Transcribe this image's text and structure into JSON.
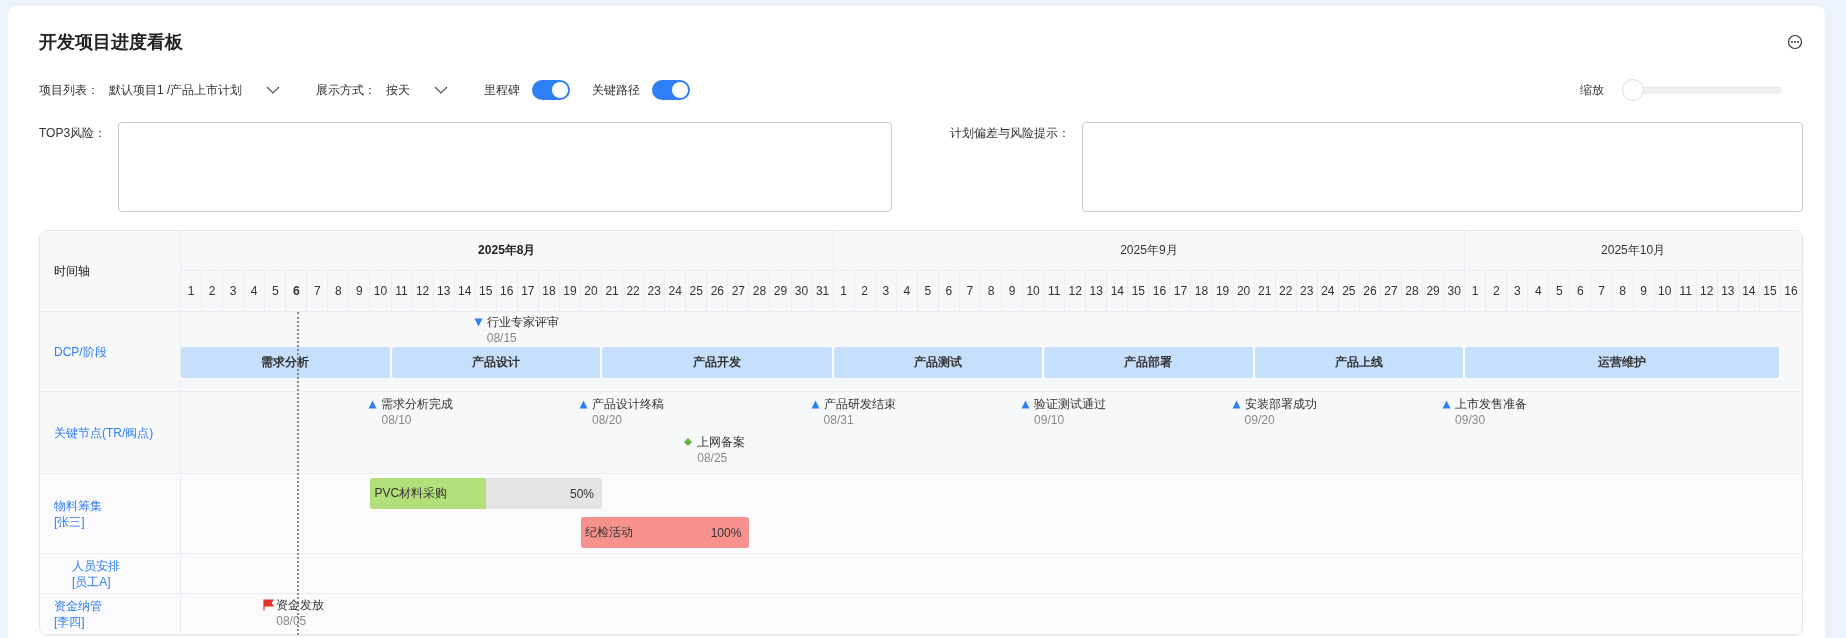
{
  "title": "开发项目进度看板",
  "filters": [
    {
      "kind": "select",
      "label": "项目列表：",
      "value": "默认项目1 /产品上市计划"
    },
    {
      "kind": "select",
      "label": "展示方式：",
      "value": "按天"
    },
    {
      "kind": "toggle",
      "label": "里程碑",
      "on": true
    },
    {
      "kind": "toggle",
      "label": "关键路径",
      "on": true
    }
  ],
  "zoom": {
    "label": "缩放",
    "level": 0
  },
  "risks": [
    {
      "label": "TOP3风险："
    },
    {
      "label": "计划偏差与风险提示："
    }
  ],
  "timeline": {
    "corner": "时间轴",
    "months": [
      {
        "label": "2025年8月",
        "current": true,
        "days": [
          {
            "label": "1",
            "today": false
          },
          {
            "label": "2",
            "today": false
          },
          {
            "label": "3",
            "today": false
          },
          {
            "label": "4",
            "today": false
          },
          {
            "label": "5",
            "today": false
          },
          {
            "label": "6",
            "today": true
          },
          {
            "label": "7",
            "today": false
          },
          {
            "label": "8",
            "today": false
          },
          {
            "label": "9",
            "today": false
          },
          {
            "label": "10",
            "today": false
          },
          {
            "label": "11",
            "today": false
          },
          {
            "label": "12",
            "today": false
          },
          {
            "label": "13",
            "today": false
          },
          {
            "label": "14",
            "today": false
          },
          {
            "label": "15",
            "today": false
          },
          {
            "label": "16",
            "today": false
          },
          {
            "label": "17",
            "today": false
          },
          {
            "label": "18",
            "today": false
          },
          {
            "label": "19",
            "today": false
          },
          {
            "label": "20",
            "today": false
          },
          {
            "label": "21",
            "today": false
          },
          {
            "label": "22",
            "today": false
          },
          {
            "label": "23",
            "today": false
          },
          {
            "label": "24",
            "today": false
          },
          {
            "label": "25",
            "today": false
          },
          {
            "label": "26",
            "today": false
          },
          {
            "label": "27",
            "today": false
          },
          {
            "label": "28",
            "today": false
          },
          {
            "label": "29",
            "today": false
          },
          {
            "label": "30",
            "today": false
          },
          {
            "label": "31",
            "today": false
          }
        ]
      },
      {
        "label": "2025年9月",
        "current": false,
        "days": [
          {
            "label": "1",
            "today": false
          },
          {
            "label": "2",
            "today": false
          },
          {
            "label": "3",
            "today": false
          },
          {
            "label": "4",
            "today": false
          },
          {
            "label": "5",
            "today": false
          },
          {
            "label": "6",
            "today": false
          },
          {
            "label": "7",
            "today": false
          },
          {
            "label": "8",
            "today": false
          },
          {
            "label": "9",
            "today": false
          },
          {
            "label": "10",
            "today": false
          },
          {
            "label": "11",
            "today": false
          },
          {
            "label": "12",
            "today": false
          },
          {
            "label": "13",
            "today": false
          },
          {
            "label": "14",
            "today": false
          },
          {
            "label": "15",
            "today": false
          },
          {
            "label": "16",
            "today": false
          },
          {
            "label": "17",
            "today": false
          },
          {
            "label": "18",
            "today": false
          },
          {
            "label": "19",
            "today": false
          },
          {
            "label": "20",
            "today": false
          },
          {
            "label": "21",
            "today": false
          },
          {
            "label": "22",
            "today": false
          },
          {
            "label": "23",
            "today": false
          },
          {
            "label": "24",
            "today": false
          },
          {
            "label": "25",
            "today": false
          },
          {
            "label": "26",
            "today": false
          },
          {
            "label": "27",
            "today": false
          },
          {
            "label": "28",
            "today": false
          },
          {
            "label": "29",
            "today": false
          },
          {
            "label": "30",
            "today": false
          }
        ]
      },
      {
        "label": "2025年10月",
        "current": false,
        "days": [
          {
            "label": "1",
            "today": false
          },
          {
            "label": "2",
            "today": false
          },
          {
            "label": "3",
            "today": false
          },
          {
            "label": "4",
            "today": false
          },
          {
            "label": "5",
            "today": false
          },
          {
            "label": "6",
            "today": false
          },
          {
            "label": "7",
            "today": false
          },
          {
            "label": "8",
            "today": false
          },
          {
            "label": "9",
            "today": false
          },
          {
            "label": "10",
            "today": false
          },
          {
            "label": "11",
            "today": false
          },
          {
            "label": "12",
            "today": false
          },
          {
            "label": "13",
            "today": false
          },
          {
            "label": "14",
            "today": false
          },
          {
            "label": "15",
            "today": false
          },
          {
            "label": "16",
            "today": false
          }
        ]
      }
    ]
  },
  "rows": [
    {
      "kind": "phases",
      "label": "DCP/阶段",
      "events": [
        {
          "kind": "down",
          "title": "行业专家评审",
          "date": "08/15"
        }
      ],
      "phases": [
        {
          "name": "需求分析"
        },
        {
          "name": "产品设计"
        },
        {
          "name": "产品开发"
        },
        {
          "name": "产品测试"
        },
        {
          "name": "产品部署"
        },
        {
          "name": "产品上线"
        },
        {
          "name": "运营维护"
        }
      ]
    },
    {
      "kind": "milestones",
      "label": "关键节点(TR/阀点)",
      "events": [
        {
          "kind": "up",
          "title": "需求分析完成",
          "date": "08/10"
        },
        {
          "kind": "up",
          "title": "产品设计终稿",
          "date": "08/20"
        },
        {
          "kind": "diamond",
          "title": "上网备案",
          "date": "08/25"
        },
        {
          "kind": "up",
          "title": "产品研发结束",
          "date": "08/31"
        },
        {
          "kind": "up",
          "title": "验证测试通过",
          "date": "09/10"
        },
        {
          "kind": "up",
          "title": "安装部署成功",
          "date": "09/20"
        },
        {
          "kind": "up",
          "title": "上市发售准备",
          "date": "09/30"
        }
      ]
    },
    {
      "kind": "tasks",
      "label": "物料筹集",
      "owner": "[张三]",
      "tasks": [
        {
          "name": "PVC材料采购",
          "percent": "50%",
          "level": 0.5,
          "color": "#b2df7a"
        },
        {
          "name": "纪检活动",
          "percent": "100%",
          "level": 1,
          "color": "#f6918d"
        }
      ],
      "children": [
        {
          "kind": "empty",
          "label": "人员安排",
          "owner": "[员工A]"
        }
      ]
    },
    {
      "kind": "events",
      "label": "资金纳管",
      "owner": "[李四]",
      "events": [
        {
          "kind": "flag",
          "title": "资金发放",
          "date": "08/05"
        }
      ]
    }
  ]
}
